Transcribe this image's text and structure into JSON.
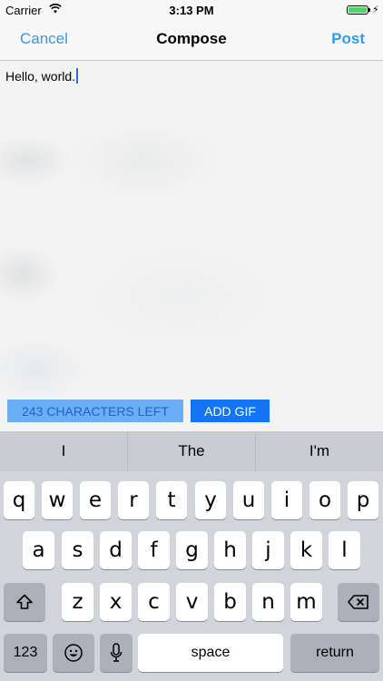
{
  "status_bar": {
    "carrier": "Carrier",
    "time": "3:13 PM",
    "icons": [
      "wifi-icon",
      "battery-icon",
      "charging-bolt-icon"
    ]
  },
  "nav": {
    "cancel_label": "Cancel",
    "title": "Compose",
    "post_label": "Post"
  },
  "compose": {
    "text": "Hello, world."
  },
  "toolbar": {
    "chars_left_label": "243 CHARACTERS LEFT",
    "add_gif_label": "ADD GIF"
  },
  "keyboard": {
    "suggestions": [
      "I",
      "The",
      "I'm"
    ],
    "row1": [
      "q",
      "w",
      "e",
      "r",
      "t",
      "y",
      "u",
      "i",
      "o",
      "p"
    ],
    "row2": [
      "a",
      "s",
      "d",
      "f",
      "g",
      "h",
      "j",
      "k",
      "l"
    ],
    "row3": [
      "z",
      "x",
      "c",
      "v",
      "b",
      "n",
      "m"
    ],
    "numbers_label": "123",
    "space_label": "space",
    "return_label": "return",
    "icons": [
      "shift-icon",
      "backspace-icon",
      "emoji-icon",
      "microphone-icon"
    ]
  },
  "colors": {
    "accent": "#2d9cf2",
    "chars_left_bg": "#6aaef5",
    "add_gif_bg": "#1574f5",
    "keyboard_bg": "#d1d5db"
  }
}
